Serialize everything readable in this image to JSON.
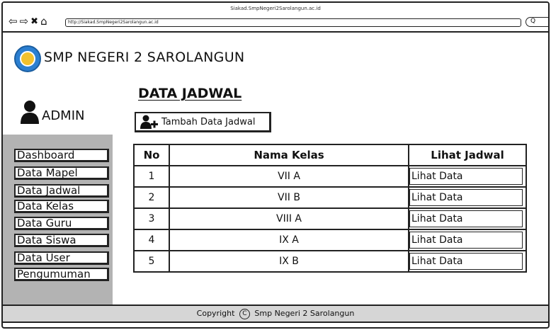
{
  "browser": {
    "title": "Siakad.SmpNegeri2Sarolangun.ac.id",
    "url": "http://Siakad.SmpNegeri2Sarolangun.ac.id",
    "search_placeholder": "Q"
  },
  "header": {
    "app_title": "SMP NEGERI 2 SAROLANGUN",
    "user_label": "ADMIN"
  },
  "sidebar": {
    "items": [
      {
        "label": "Dashboard"
      },
      {
        "label": "Data Mapel"
      },
      {
        "label": "Data Jadwal"
      },
      {
        "label": "Data Kelas"
      },
      {
        "label": "Data Guru"
      },
      {
        "label": "Data Siswa"
      },
      {
        "label": "Data User"
      },
      {
        "label": "Pengumuman"
      }
    ]
  },
  "main": {
    "page_title": "DATA JADWAL",
    "add_button_label": "Tambah Data Jadwal",
    "table": {
      "headers": [
        "No",
        "Nama Kelas",
        "Lihat Jadwal"
      ],
      "rows": [
        {
          "no": "1",
          "kelas": "VII A",
          "action": "Lihat Data"
        },
        {
          "no": "2",
          "kelas": "VII B",
          "action": "Lihat Data"
        },
        {
          "no": "3",
          "kelas": "VIII A",
          "action": "Lihat Data"
        },
        {
          "no": "4",
          "kelas": "IX A",
          "action": "Lihat Data"
        },
        {
          "no": "5",
          "kelas": "IX B",
          "action": "Lihat Data"
        }
      ]
    }
  },
  "footer": {
    "text_before": "Copyright",
    "copyright_symbol": "C",
    "text_after": "Smp Negeri 2 Sarolangun"
  }
}
